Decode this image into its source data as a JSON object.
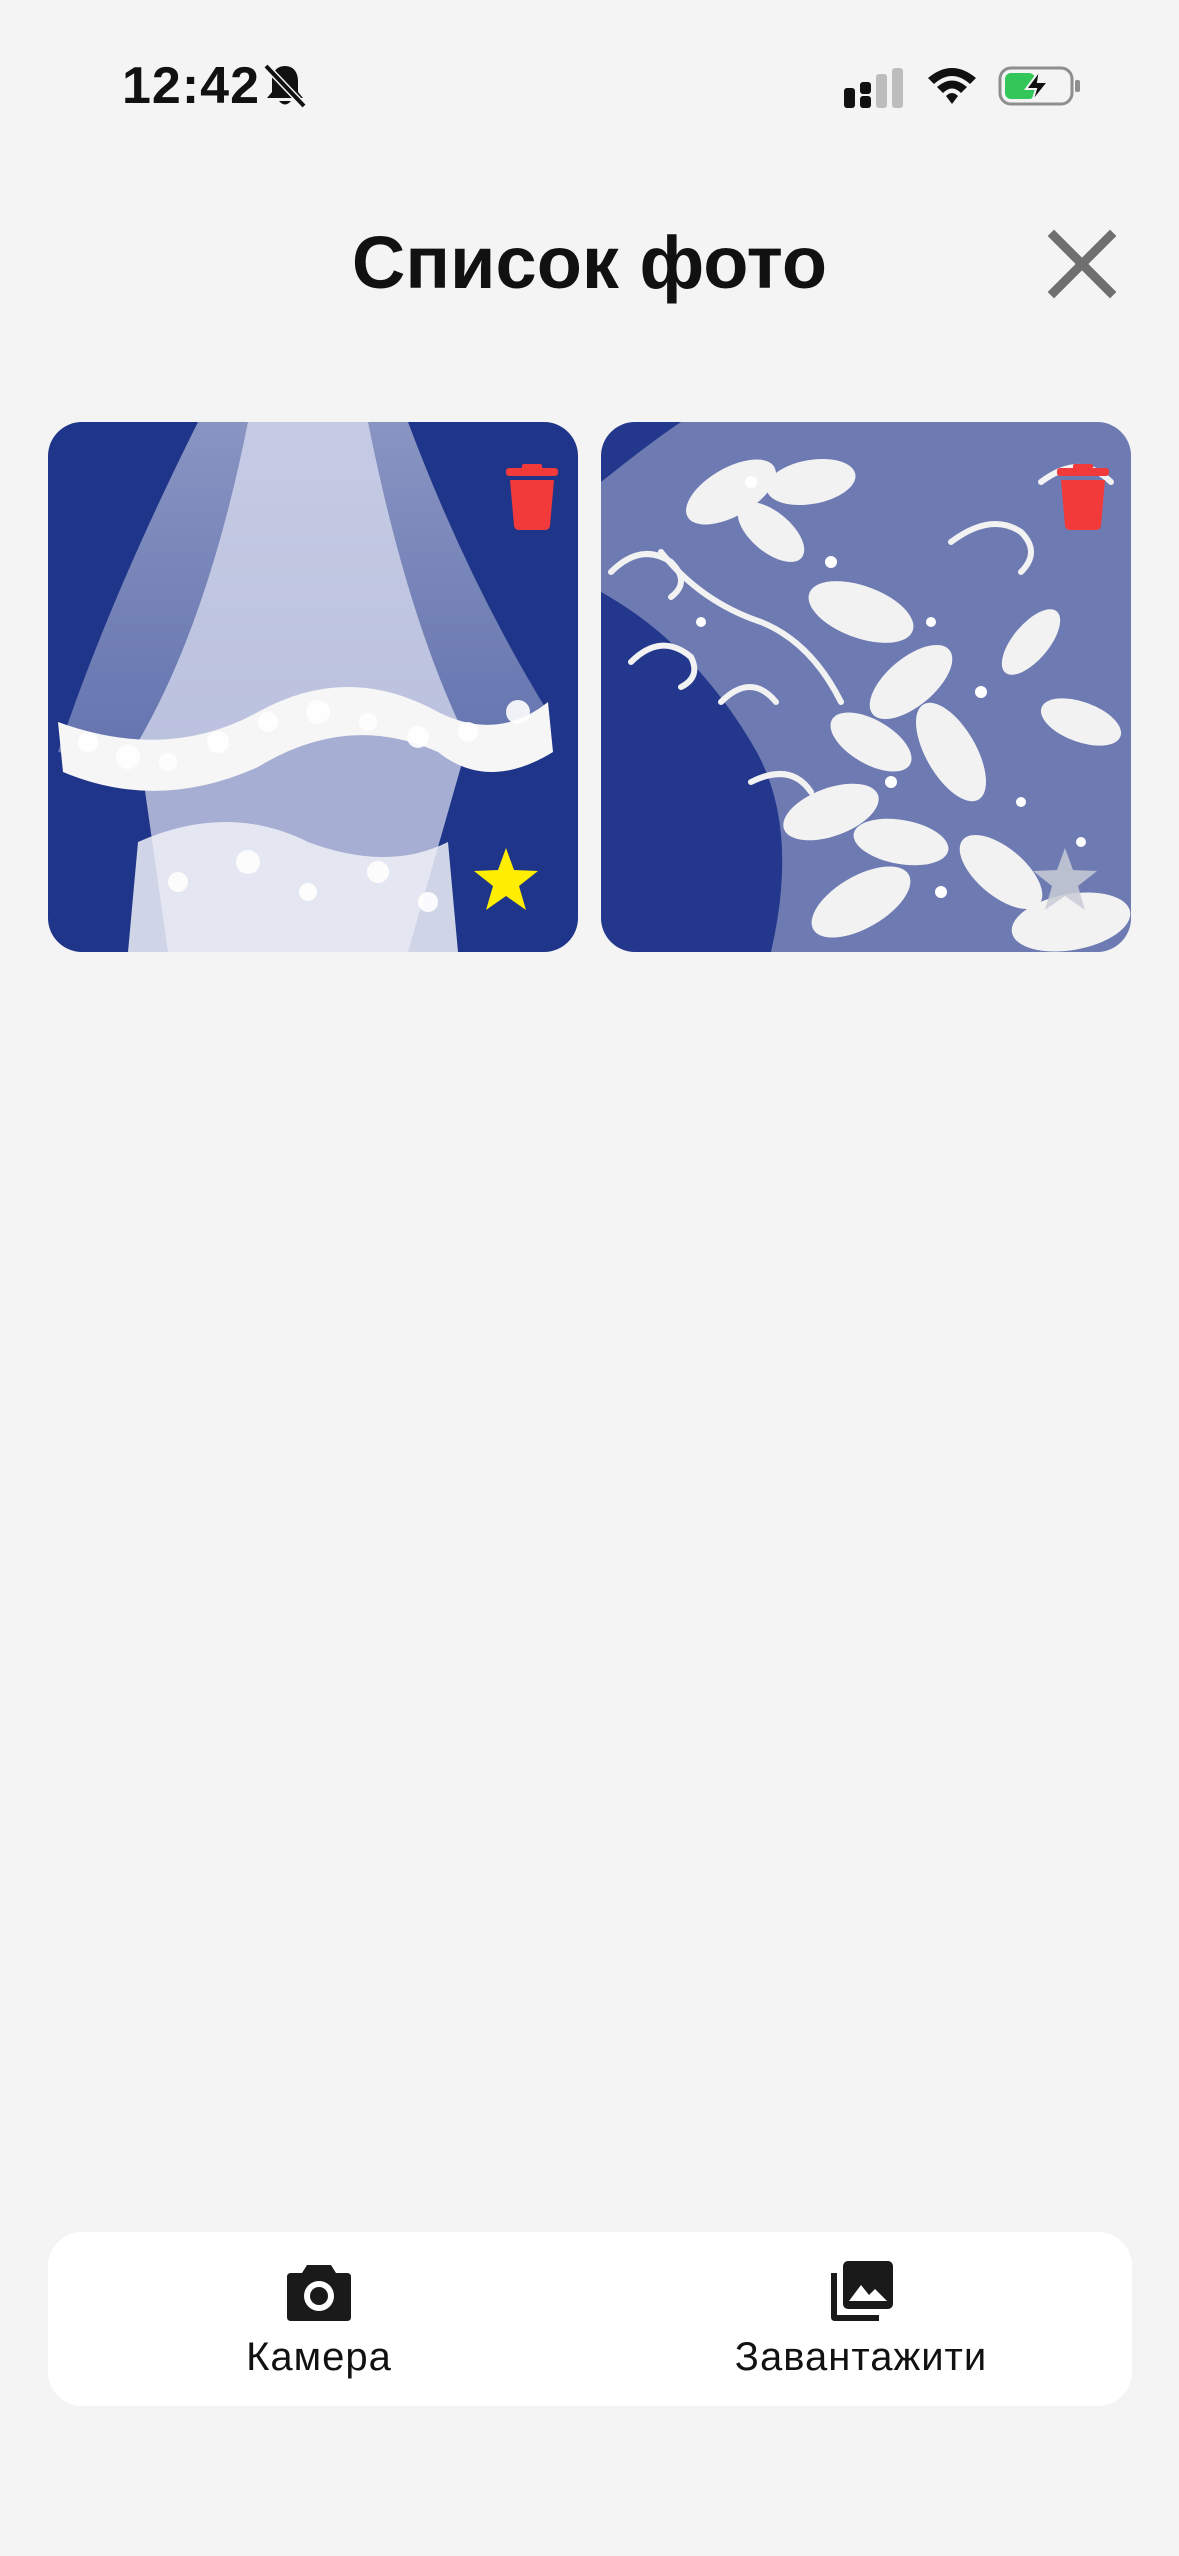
{
  "status_bar": {
    "time": "12:42",
    "icons": [
      "bell-off-icon",
      "signal-icon",
      "wifi-icon",
      "battery-charging-icon"
    ],
    "battery_color": "#33c759"
  },
  "header": {
    "title": "Список фото",
    "close_icon": "close-icon"
  },
  "photos": [
    {
      "subject": "bridal-veil-lace",
      "favorite": true,
      "delete_icon": "trash-icon",
      "star_color": "#ffee00"
    },
    {
      "subject": "lace-applique",
      "favorite": false,
      "delete_icon": "trash-icon",
      "star_color": "#c9ccd6"
    }
  ],
  "colors": {
    "background": "#f4f4f4",
    "delete_red": "#f23a3a",
    "photo_backdrop": "#1f3589"
  },
  "bottom_bar": {
    "camera": {
      "label": "Камера",
      "icon": "camera-icon"
    },
    "upload": {
      "label": "Завантажити",
      "icon": "photo-library-icon"
    }
  }
}
